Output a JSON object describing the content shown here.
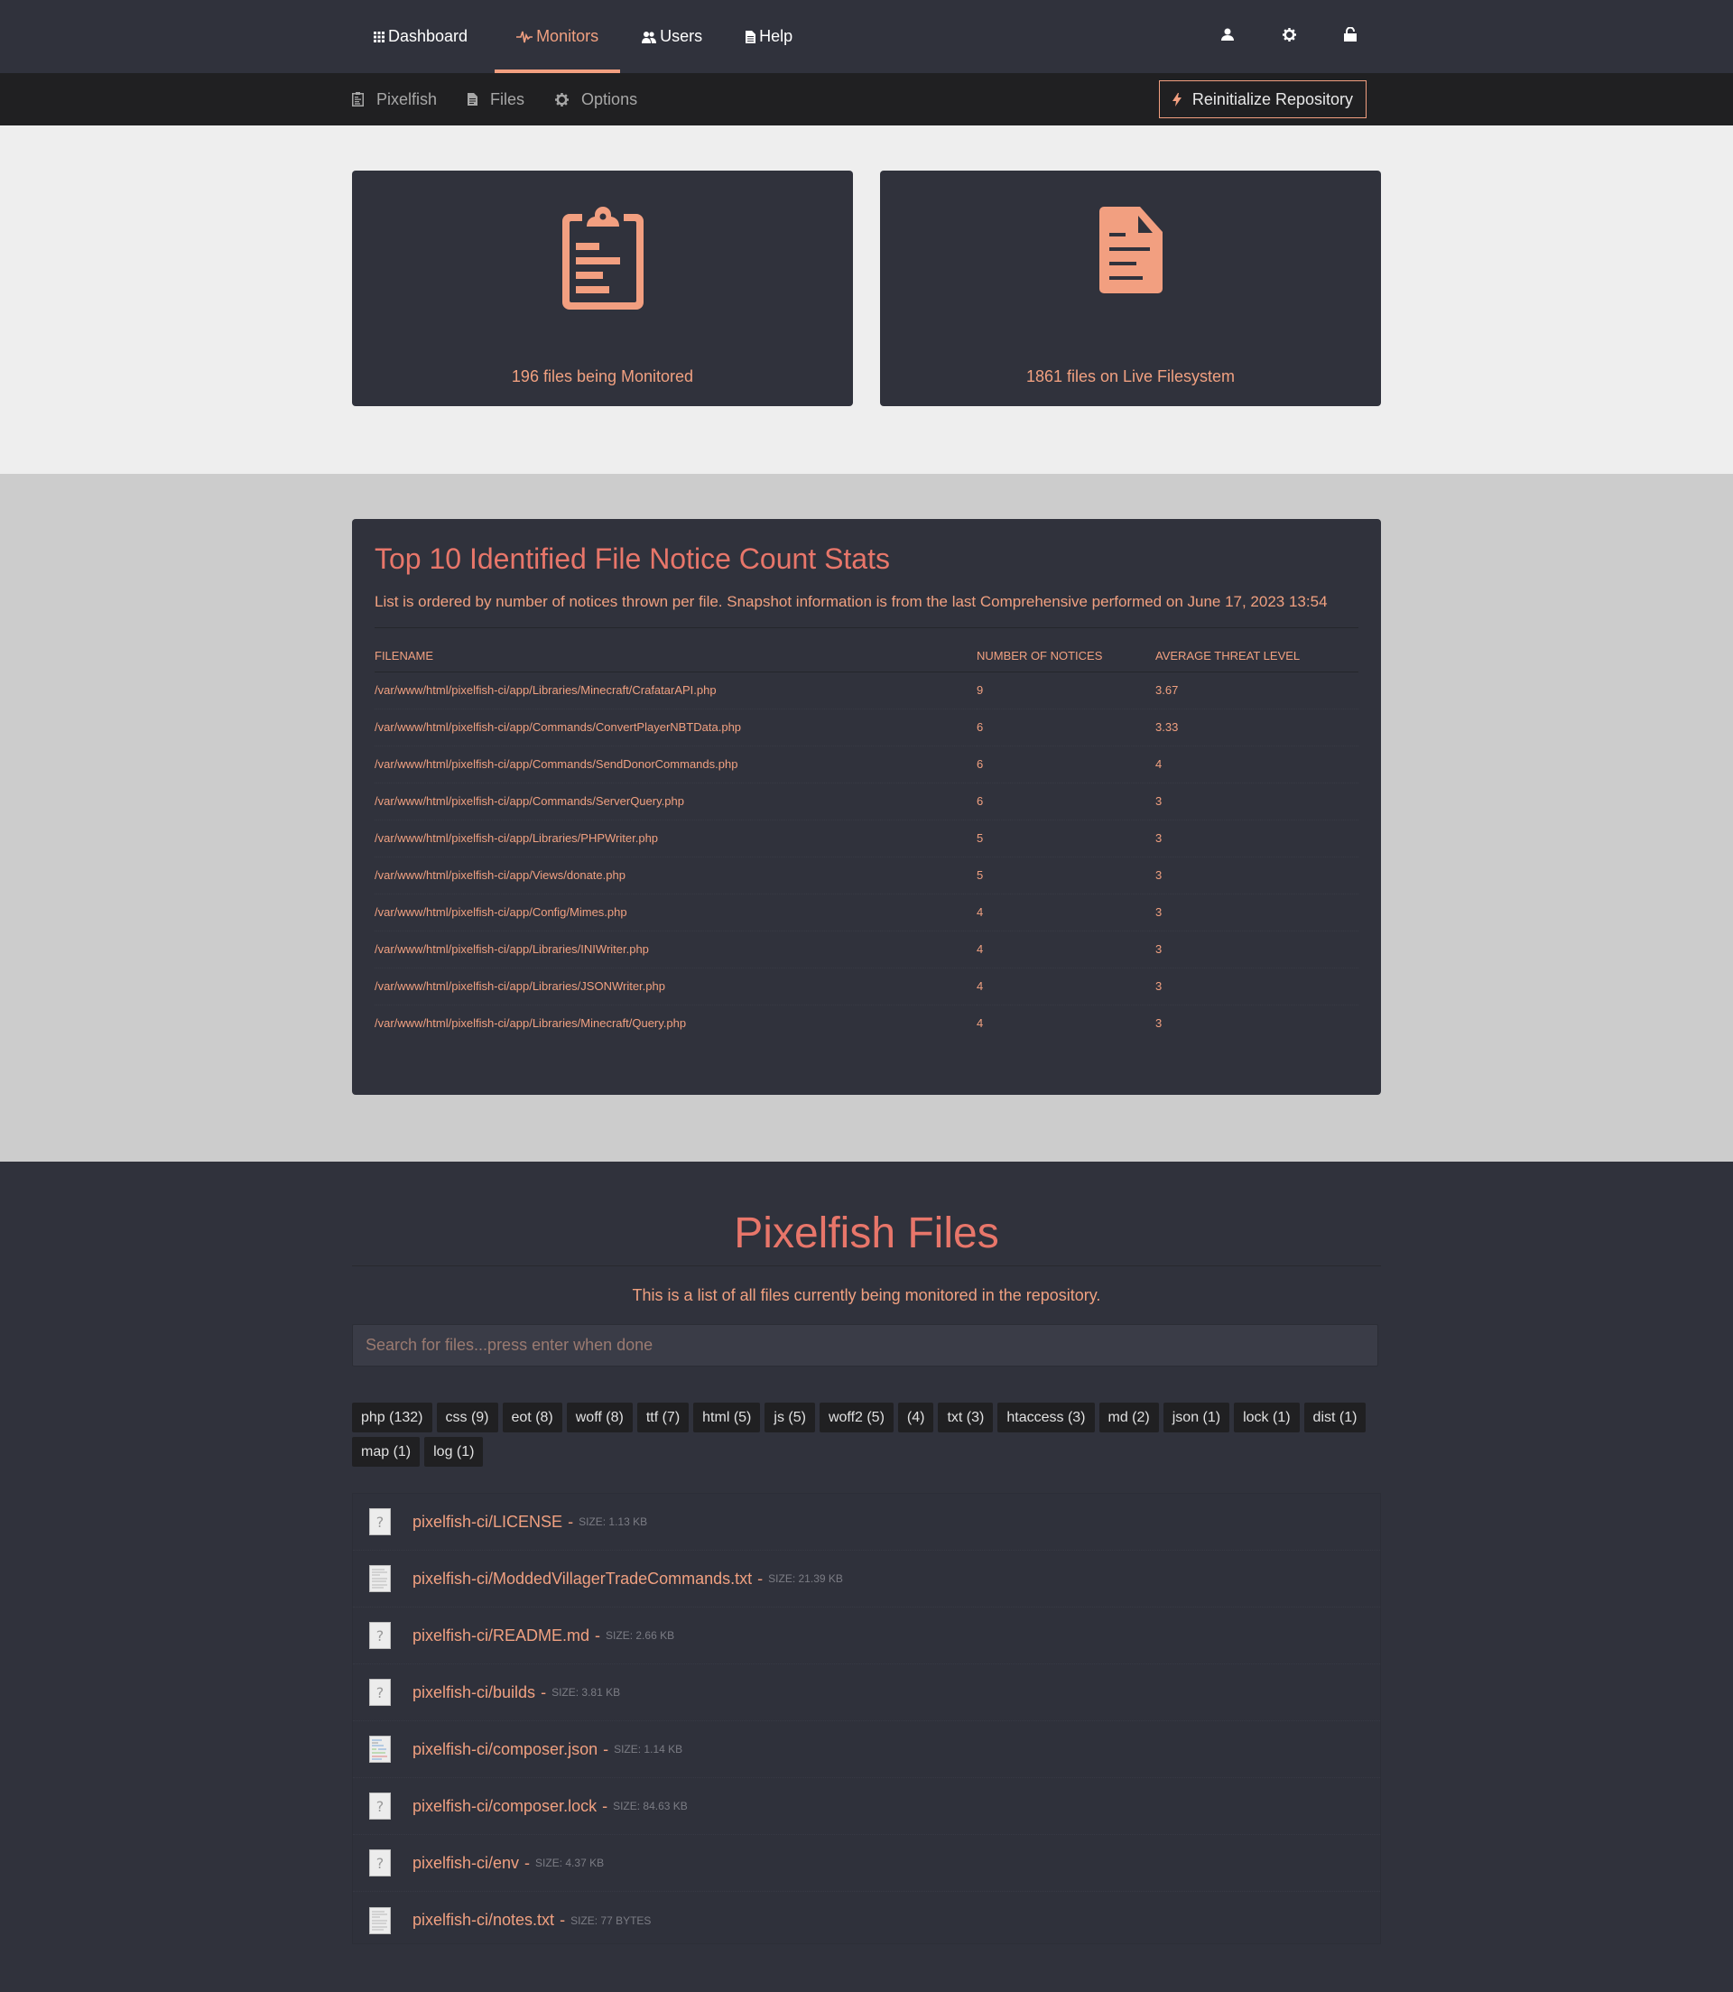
{
  "nav": {
    "items": [
      {
        "label": "Dashboard",
        "icon": "grid-icon",
        "active": false
      },
      {
        "label": "Monitors",
        "icon": "heartbeat-icon",
        "active": true
      },
      {
        "label": "Users",
        "icon": "users-icon",
        "active": false
      },
      {
        "label": "Help",
        "icon": "document-icon",
        "active": false
      }
    ],
    "right_icons": [
      "user-icon",
      "gear-icon",
      "unlock-icon"
    ]
  },
  "subnav": {
    "items": [
      {
        "label": "Pixelfish",
        "icon": "clipboard-icon"
      },
      {
        "label": "Files",
        "icon": "file-icon"
      },
      {
        "label": "Options",
        "icon": "gear-icon"
      }
    ],
    "reinit_label": "Reinitialize Repository"
  },
  "cards": {
    "monitored": {
      "label": "196 files being Monitored",
      "icon": "clipboard-icon"
    },
    "live": {
      "label": "1861 files on Live Filesystem",
      "icon": "file-text-icon"
    }
  },
  "stats": {
    "title": "Top 10 Identified File Notice Count Stats",
    "description": "List is ordered by number of notices thrown per file. Snapshot information is from the last Comprehensive performed on June 17, 2023 13:54",
    "columns": [
      "Filename",
      "Number of Notices",
      "Average Threat Level"
    ],
    "rows": [
      {
        "file": "/var/www/html/pixelfish-ci/app/Libraries/Minecraft/CrafatarAPI.php",
        "notices": "9",
        "threat": "3.67"
      },
      {
        "file": "/var/www/html/pixelfish-ci/app/Commands/ConvertPlayerNBTData.php",
        "notices": "6",
        "threat": "3.33"
      },
      {
        "file": "/var/www/html/pixelfish-ci/app/Commands/SendDonorCommands.php",
        "notices": "6",
        "threat": "4"
      },
      {
        "file": "/var/www/html/pixelfish-ci/app/Commands/ServerQuery.php",
        "notices": "6",
        "threat": "3"
      },
      {
        "file": "/var/www/html/pixelfish-ci/app/Libraries/PHPWriter.php",
        "notices": "5",
        "threat": "3"
      },
      {
        "file": "/var/www/html/pixelfish-ci/app/Views/donate.php",
        "notices": "5",
        "threat": "3"
      },
      {
        "file": "/var/www/html/pixelfish-ci/app/Config/Mimes.php",
        "notices": "4",
        "threat": "3"
      },
      {
        "file": "/var/www/html/pixelfish-ci/app/Libraries/INIWriter.php",
        "notices": "4",
        "threat": "3"
      },
      {
        "file": "/var/www/html/pixelfish-ci/app/Libraries/JSONWriter.php",
        "notices": "4",
        "threat": "3"
      },
      {
        "file": "/var/www/html/pixelfish-ci/app/Libraries/Minecraft/Query.php",
        "notices": "4",
        "threat": "3"
      }
    ]
  },
  "files": {
    "title": "Pixelfish Files",
    "description": "This is a list of all files currently being monitored in the repository.",
    "search_placeholder": "Search for files...press enter when done",
    "search_value": "",
    "tags": [
      "php (132)",
      "css (9)",
      "eot (8)",
      "woff (8)",
      "ttf (7)",
      "html (5)",
      "js (5)",
      "woff2 (5)",
      "(4)",
      "txt (3)",
      "htaccess (3)",
      "md (2)",
      "json (1)",
      "lock (1)",
      "dist (1)",
      "map (1)",
      "log (1)"
    ],
    "separator": "-",
    "list": [
      {
        "name": "pixelfish-ci/LICENSE",
        "size": "SIZE: 1.13 KB",
        "icon": "unknown-file-icon"
      },
      {
        "name": "pixelfish-ci/ModdedVillagerTradeCommands.txt",
        "size": "SIZE: 21.39 KB",
        "icon": "text-file-icon"
      },
      {
        "name": "pixelfish-ci/README.md",
        "size": "SIZE: 2.66 KB",
        "icon": "unknown-file-icon"
      },
      {
        "name": "pixelfish-ci/builds",
        "size": "SIZE: 3.81 KB",
        "icon": "unknown-file-icon"
      },
      {
        "name": "pixelfish-ci/composer.json",
        "size": "SIZE: 1.14 KB",
        "icon": "code-file-icon"
      },
      {
        "name": "pixelfish-ci/composer.lock",
        "size": "SIZE: 84.63 KB",
        "icon": "unknown-file-icon"
      },
      {
        "name": "pixelfish-ci/env",
        "size": "SIZE: 4.37 KB",
        "icon": "unknown-file-icon"
      },
      {
        "name": "pixelfish-ci/notes.txt",
        "size": "SIZE: 77 BYTES",
        "icon": "text-file-icon"
      }
    ]
  },
  "colors": {
    "accent": "#f29f80",
    "heading": "#e8766a",
    "panel": "#30323c",
    "subnav": "#202022"
  }
}
